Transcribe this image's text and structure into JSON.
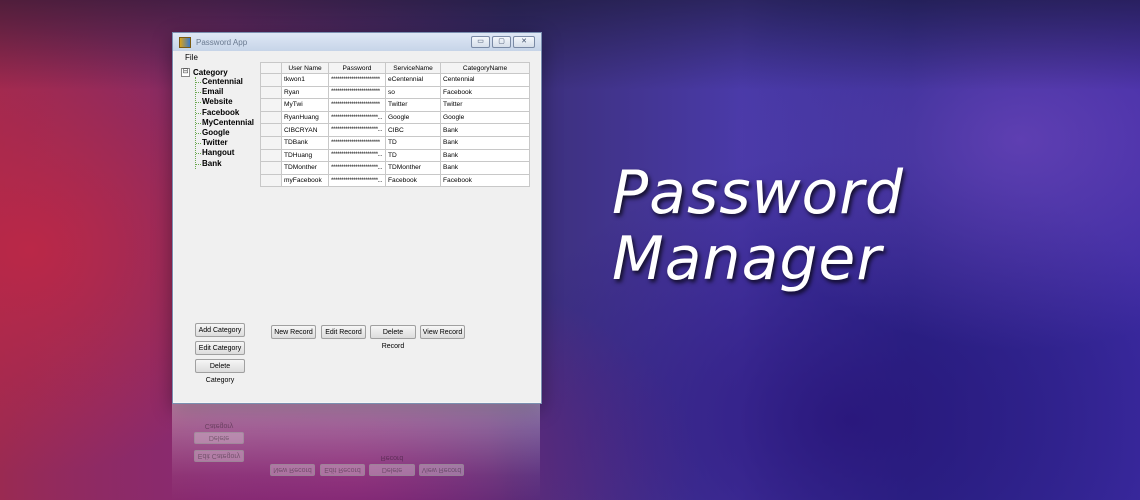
{
  "window": {
    "title": "Password App",
    "controls": [
      "▭",
      "▢",
      "✕"
    ],
    "menu": [
      "File"
    ]
  },
  "tree": {
    "root": "Category",
    "expander": "⊟",
    "items": [
      "Centennial",
      "Email",
      "Website",
      "Facebook",
      "MyCentennial",
      "Google",
      "Twitter",
      "Hangout",
      "Bank"
    ]
  },
  "grid": {
    "columns": [
      "User Name",
      "Password",
      "ServiceName",
      "CategoryName"
    ],
    "rows": [
      [
        "tkwon1",
        "************************",
        "eCentennial",
        "Centennial"
      ],
      [
        "Ryan",
        "************************",
        "so",
        "Facebook"
      ],
      [
        "MyTwi",
        "************************",
        "Twitter",
        "Twitter"
      ],
      [
        "RyanHuang",
        "***********************...",
        "Google",
        "Google"
      ],
      [
        "CIBCRYAN",
        "***********************...",
        "CIBC",
        "Bank"
      ],
      [
        "TDBank",
        "************************",
        "TD",
        "Bank"
      ],
      [
        "TDHuang",
        "***********************...",
        "TD",
        "Bank"
      ],
      [
        "TDMonther",
        "***********************...",
        "TDMonther",
        "Bank"
      ],
      [
        "myFacebook",
        "***********************...",
        "Facebook",
        "Facebook"
      ]
    ]
  },
  "category_buttons": {
    "add": "Add Category",
    "edit": "Edit Category",
    "delete": "Delete Category"
  },
  "record_buttons": {
    "new": "New Record",
    "edit": "Edit Record",
    "delete": "Delete Record",
    "view": "View Record"
  },
  "headline": {
    "line1": "Password",
    "line2": "Manager"
  }
}
